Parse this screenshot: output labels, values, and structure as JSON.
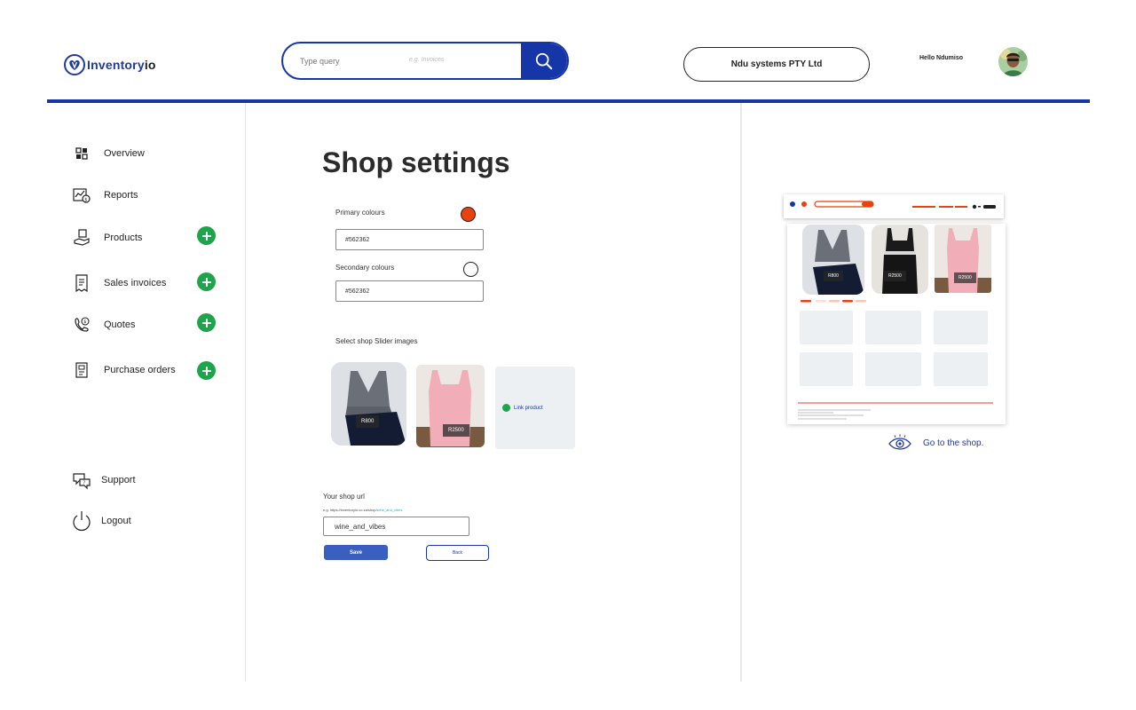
{
  "header": {
    "logo_prefix": "Inventory",
    "logo_suffix": "io",
    "search_placeholder": "Type query",
    "search_hint": "e.g. Invoices",
    "company_name": "Ndu systems PTY Ltd",
    "greeting": "Hello Ndumiso"
  },
  "sidebar": {
    "items": [
      {
        "label": "Overview",
        "icon": "overview-icon"
      },
      {
        "label": "Reports",
        "icon": "reports-icon"
      },
      {
        "label": "Products",
        "icon": "products-icon",
        "add": true
      },
      {
        "label": "Sales invoices",
        "icon": "sales-invoices-icon",
        "add": true
      },
      {
        "label": "Quotes",
        "icon": "quotes-icon",
        "add": true
      },
      {
        "label": "Purchase orders",
        "icon": "purchase-orders-icon",
        "add": true
      }
    ],
    "support_label": "Support",
    "logout_label": "Logout"
  },
  "main": {
    "title": "Shop settings",
    "primary_label": "Primary colours",
    "primary_value": "#562362",
    "primary_swatch": "#e8420f",
    "secondary_label": "Secondary colours",
    "secondary_value": "#562362",
    "secondary_swatch": "#ffffff",
    "slider_label": "Select shop Slider  images",
    "slider_prices": [
      "R800",
      "R2500"
    ],
    "link_product_label": "Link product",
    "url_label": "Your shop url",
    "url_hint_prefix": "e.g. https://inventoryio.co.za/shop/",
    "url_hint_slug": "wine_and_vibes",
    "url_value": "wine_and_vibes",
    "save_label": "Save",
    "back_label": "Back"
  },
  "preview": {
    "prices": [
      "R800",
      "R2500",
      "R2500"
    ],
    "go_to_shop_label": "Go to the shop."
  },
  "colors": {
    "brand_blue": "#1636a8",
    "accent_orange": "#e8420f",
    "add_green": "#1ea54c"
  }
}
